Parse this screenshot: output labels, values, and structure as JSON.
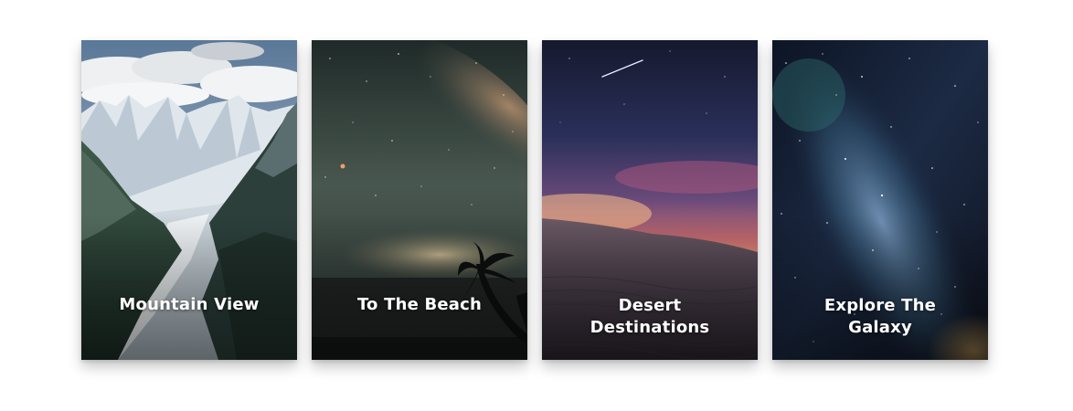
{
  "cards": [
    {
      "title": "Mountain View",
      "scene": "snowy-mountain-valley-photo"
    },
    {
      "title": "To The Beach",
      "scene": "night-beach-milky-way-photo"
    },
    {
      "title": "Desert Destinations",
      "scene": "desert-dune-sunset-photo"
    },
    {
      "title": "Explore The Galaxy",
      "scene": "milky-way-galaxy-photo"
    }
  ]
}
